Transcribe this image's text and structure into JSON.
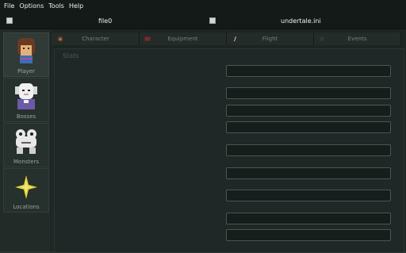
{
  "menubar": {
    "items": [
      "File",
      "Options",
      "Tools",
      "Help"
    ]
  },
  "files": {
    "left_name": "file0",
    "right_name": "undertale.ini"
  },
  "sidebar": {
    "items": [
      {
        "label": "Player",
        "icon": "frisk-icon"
      },
      {
        "label": "Bosses",
        "icon": "toriel-icon"
      },
      {
        "label": "Monsters",
        "icon": "froggit-icon"
      },
      {
        "label": "Locations",
        "icon": "save-star-icon"
      }
    ]
  },
  "tabs": [
    {
      "label": "Character",
      "icon": "character-icon"
    },
    {
      "label": "Equipment",
      "icon": "equipment-icon"
    },
    {
      "label": "Flight",
      "icon": "flight-icon"
    },
    {
      "label": "Events",
      "icon": "events-icon"
    }
  ],
  "stats": {
    "title": "Stats",
    "fields": [
      "",
      "",
      "",
      "",
      "",
      "",
      "",
      "",
      "",
      ""
    ]
  },
  "colors": {
    "background": "#2a3330",
    "menubar": "#141a18",
    "field_border": "#4a5653",
    "star_yellow": "#e0d23a"
  }
}
